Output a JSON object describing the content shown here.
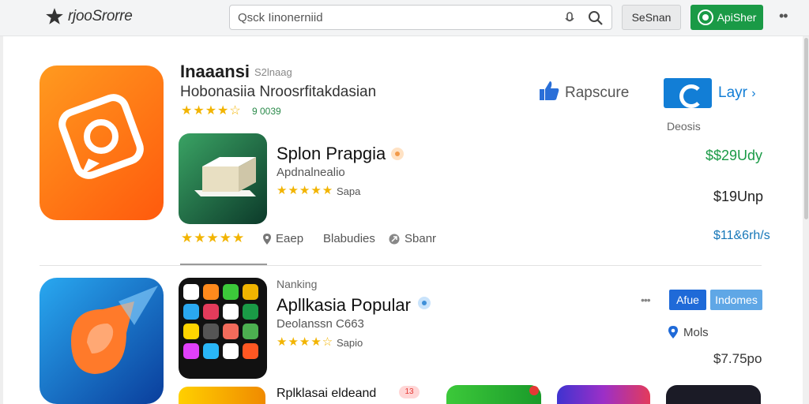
{
  "header": {
    "brand": "rjooSrorre",
    "search_placeholder": "Qsck Iinonerniid",
    "search_button": "SeSnan",
    "primary_button": "ApiSher"
  },
  "featured": {
    "title": "Inaaansi",
    "subtitle": "S2lnaag",
    "description": "Hobonasiia Nroosrfitakdasian",
    "rating_count": "9 0039",
    "like_label": "Rapscure",
    "layr_label": "Layr",
    "deals_label": "Deosis",
    "price_top": "$$29Udy"
  },
  "app1": {
    "title": "Splon Prapgia",
    "category": "Apdnalnealio",
    "rating_count": "Sapa",
    "price": "$19Unp",
    "meta": [
      "Eaep",
      "Blabudies",
      "Sbanr"
    ],
    "sub_price": "$11&6rh/s"
  },
  "section2": {
    "label": "Nanking",
    "title": "Apllkasia Popular",
    "subtitle": "Deolanssn C663",
    "rating_count": "Sapio",
    "btn_left": "Afue",
    "btn_right": "Indomes",
    "location": "Mols",
    "price": "$7.75po",
    "more": "•••"
  },
  "section3": {
    "title": "Rplklasai eldeand",
    "badge": "13"
  },
  "colors": {
    "accent_green": "#1a9a46",
    "accent_blue": "#127ed6",
    "star": "#f2b400"
  }
}
